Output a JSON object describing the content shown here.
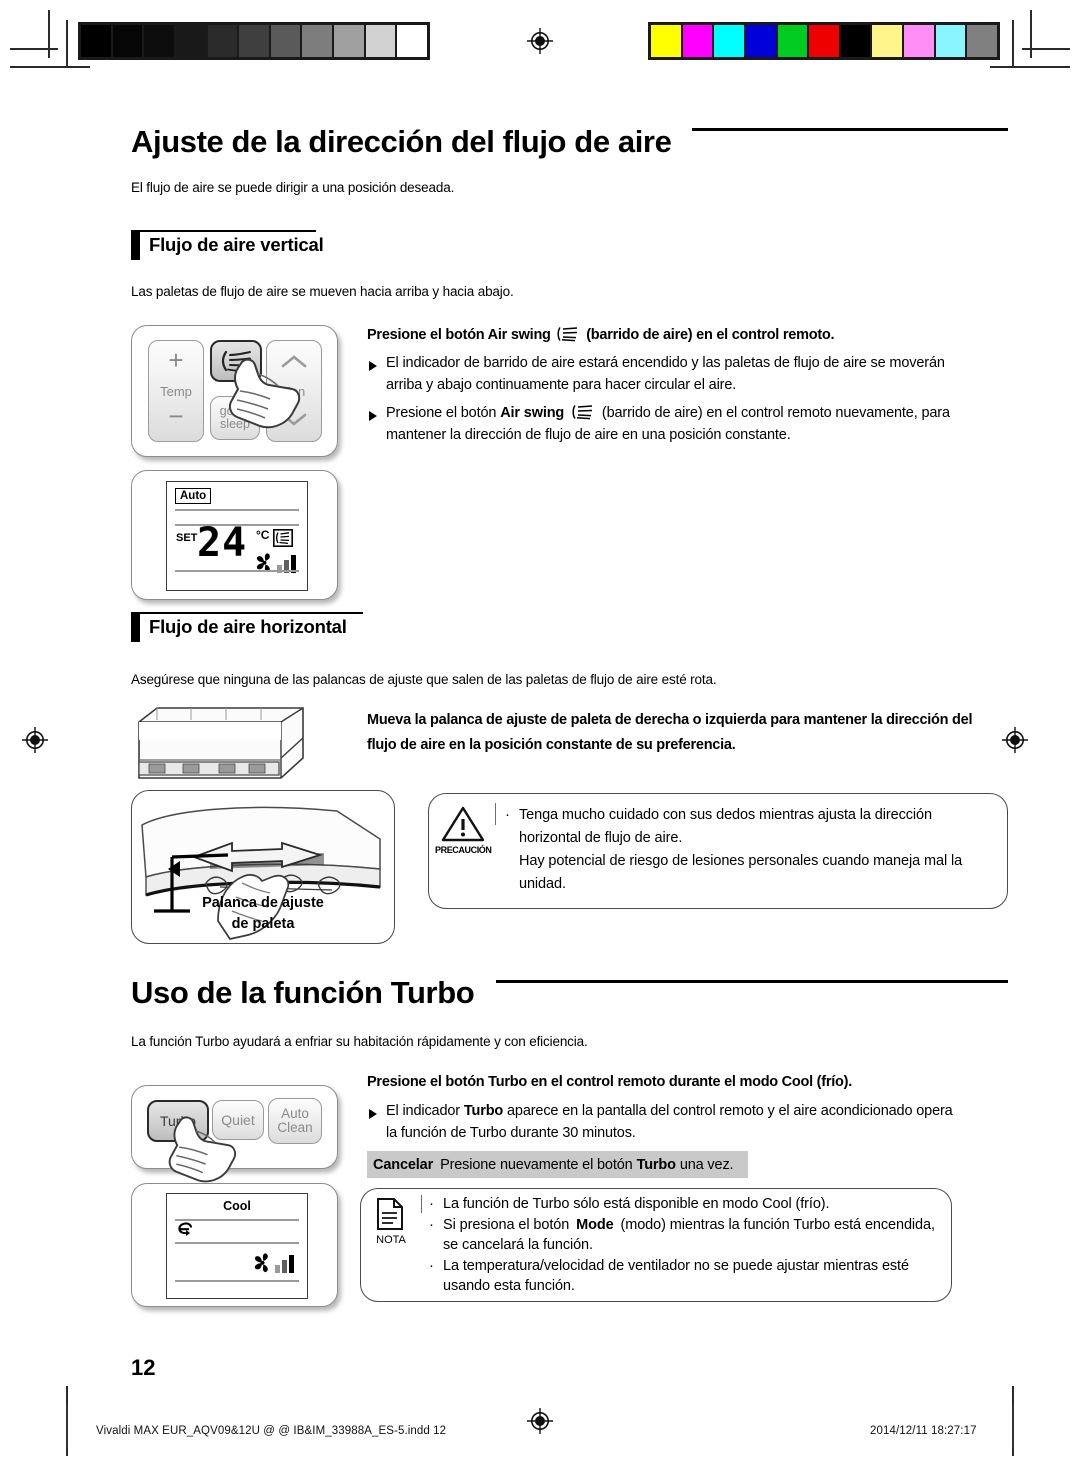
{
  "document": {
    "page_number": "12",
    "footer_left": "Vivaldi MAX EUR_AQV09&12U @ @  IB&IM_33988A_ES-5.indd   12",
    "footer_right": "2014/12/11   18:27:17"
  },
  "prepress": {
    "gray_bar": {
      "name": "grayscale-step-wedge",
      "swatches": [
        "#000000",
        "#060606",
        "#0d0d0d",
        "#191919",
        "#2b2b2b",
        "#3f3f3f",
        "#5a5a5a",
        "#7d7d7d",
        "#a0a0a0",
        "#d2d2d2",
        "#ffffff"
      ]
    },
    "color_bar": {
      "name": "process-color-bar",
      "swatches": [
        "#ffff00",
        "#ff00ff",
        "#00ffff",
        "#0000d8",
        "#00cc22",
        "#ee0000",
        "#000000",
        "#fff58a",
        "#ff8ef5",
        "#8af5ff",
        "#808080"
      ]
    }
  },
  "section_airflow": {
    "title": "Ajuste de la dirección del flujo de aire",
    "intro": "El flujo de aire se puede dirigir a una posición deseada.",
    "vertical": {
      "heading": "Flujo de aire vertical",
      "description": "Las paletas de flujo de aire se mueven hacia arriba y hacia abajo.",
      "lead_pre": "Presione el botón Air swing",
      "lead_post": "(barrido de aire) en el control remoto.",
      "bullets": [
        "El indicador de barrido de aire estará encendido y las paletas de flujo de aire se moverán arriba y abajo continuamente para hacer circular el aire.",
        "Presione el botón Air swing (barrido de aire) en el control remoto nuevamente, para mantener la dirección de flujo de aire en una posición constante."
      ],
      "bullet2_pre": "Presione el botón",
      "bullet2_bold": "Air swing",
      "bullet2_post": "(barrido de aire) en el control remoto nuevamente, para mantener la dirección de flujo de aire en una posición constante.",
      "remote": {
        "temp_label": "Temp",
        "temp_plus": "+",
        "temp_minus": "−",
        "fan_label": "Fan",
        "fan_up": "chevron-up",
        "fan_down": "chevron-down",
        "good_sleep_line1": "good’",
        "good_sleep_line2": "sleep",
        "swing_button": "air-swing"
      },
      "display": {
        "mode": "Auto",
        "set_label": "SET",
        "temperature": "24",
        "unit": "°C",
        "icons": [
          "air-swing-indicator",
          "fan-speed-bars"
        ]
      }
    },
    "horizontal": {
      "heading": "Flujo de aire horizontal",
      "description": "Asegúrese que ninguna de las palancas de ajuste que salen de las paletas de flujo de aire esté rota.",
      "lead": "Mueva la palanca de ajuste de paleta de derecha o izquierda para mantener la dirección del flujo de aire en la posición constante de su preferencia.",
      "art_label_line1": "Palanca de ajuste",
      "art_label_line2": "de paleta",
      "caution": {
        "label": "PRECAUCIÓN",
        "items": [
          "Tenga mucho cuidado con sus dedos mientras ajusta la dirección horizontal de flujo de aire.",
          "Hay potencial de riesgo de lesiones personales cuando maneja mal la unidad."
        ]
      }
    }
  },
  "section_turbo": {
    "title": "Uso de la función Turbo",
    "intro": "La función Turbo ayudará a enfriar su habitación rápidamente y con eficiencia.",
    "lead": "Presione el botón Turbo en el control remoto durante el modo Cool (frío).",
    "bullet_pre": "El indicador",
    "bullet_bold": "Turbo",
    "bullet_post": "aparece en la pantalla del control remoto y el aire acondicionado opera la función de Turbo durante 30 minutos.",
    "cancel_label": "Cancelar",
    "cancel_pre": "Presione nuevamente el botón",
    "cancel_bold": "Turbo",
    "cancel_post": "una vez.",
    "remote": {
      "turbo": "Turbo",
      "quiet": "Quiet",
      "auto_clean_line1": "Auto",
      "auto_clean_line2": "Clean"
    },
    "display": {
      "mode": "Cool",
      "icons": [
        "turbo-indicator",
        "fan-speed-bars"
      ]
    },
    "note": {
      "label": "NOTA",
      "items": [
        "La función de Turbo sólo está disponible en modo Cool (frío).",
        "Si presiona el botón Mode (modo) mientras la función Turbo está encendida, se cancelará la función.",
        "La temperatura/velocidad de ventilador no se puede ajustar mientras esté usando esta función."
      ],
      "item2_pre": "Si presiona el botón",
      "item2_bold": "Mode",
      "item2_post": "(modo) mientras la función Turbo está encendida, se cancelará la función."
    }
  }
}
